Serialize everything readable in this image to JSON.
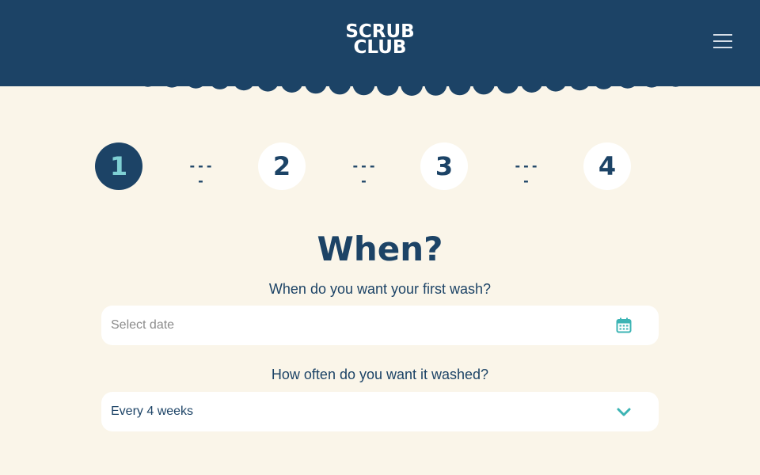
{
  "header": {
    "logo_line1": "SCRUB",
    "logo_line2": "CLUB"
  },
  "steps": [
    {
      "label": "1",
      "active": true
    },
    {
      "label": "2",
      "active": false
    },
    {
      "label": "3",
      "active": false
    },
    {
      "label": "4",
      "active": false
    }
  ],
  "step_separator": "----",
  "form": {
    "title": "When?",
    "date_label": "When do you want your first wash?",
    "date_placeholder": "Select date",
    "frequency_label": "How often do you want it washed?",
    "frequency_value": "Every 4 weeks"
  },
  "colors": {
    "primary": "#1c4366",
    "accent": "#3cb4b4",
    "background": "#faf5e9",
    "active_step_text": "#7fd0d4"
  },
  "icons": {
    "menu": "hamburger-menu-icon",
    "date": "calendar-icon",
    "dropdown": "chevron-down-icon"
  }
}
